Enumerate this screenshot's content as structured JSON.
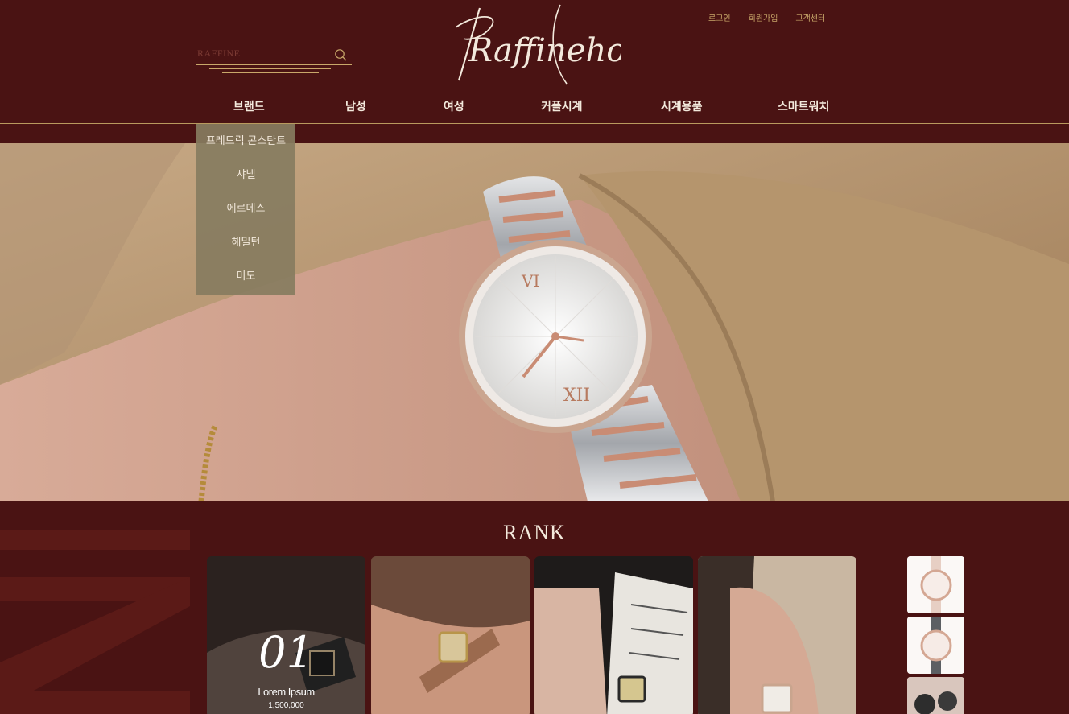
{
  "header": {
    "logo_text": "Raffinehorloge",
    "top_links": [
      "로그인",
      "회원가입",
      "고객센터"
    ],
    "search": {
      "value": "RAFFINE"
    }
  },
  "nav": {
    "items": [
      "브랜드",
      "남성",
      "여성",
      "커플시계",
      "시계용품",
      "스마트워치"
    ]
  },
  "dropdown": {
    "items": [
      "프레드릭 콘스탄트",
      "샤넬",
      "에르메스",
      "해밀턴",
      "미도"
    ]
  },
  "rank": {
    "title": "RANK",
    "featured": {
      "number": "01",
      "name": "Lorem Ipsum",
      "price": "1,500,000"
    }
  },
  "colors": {
    "background": "#4a1313",
    "accent": "#c9a86a",
    "dropdown": "#877c60"
  }
}
